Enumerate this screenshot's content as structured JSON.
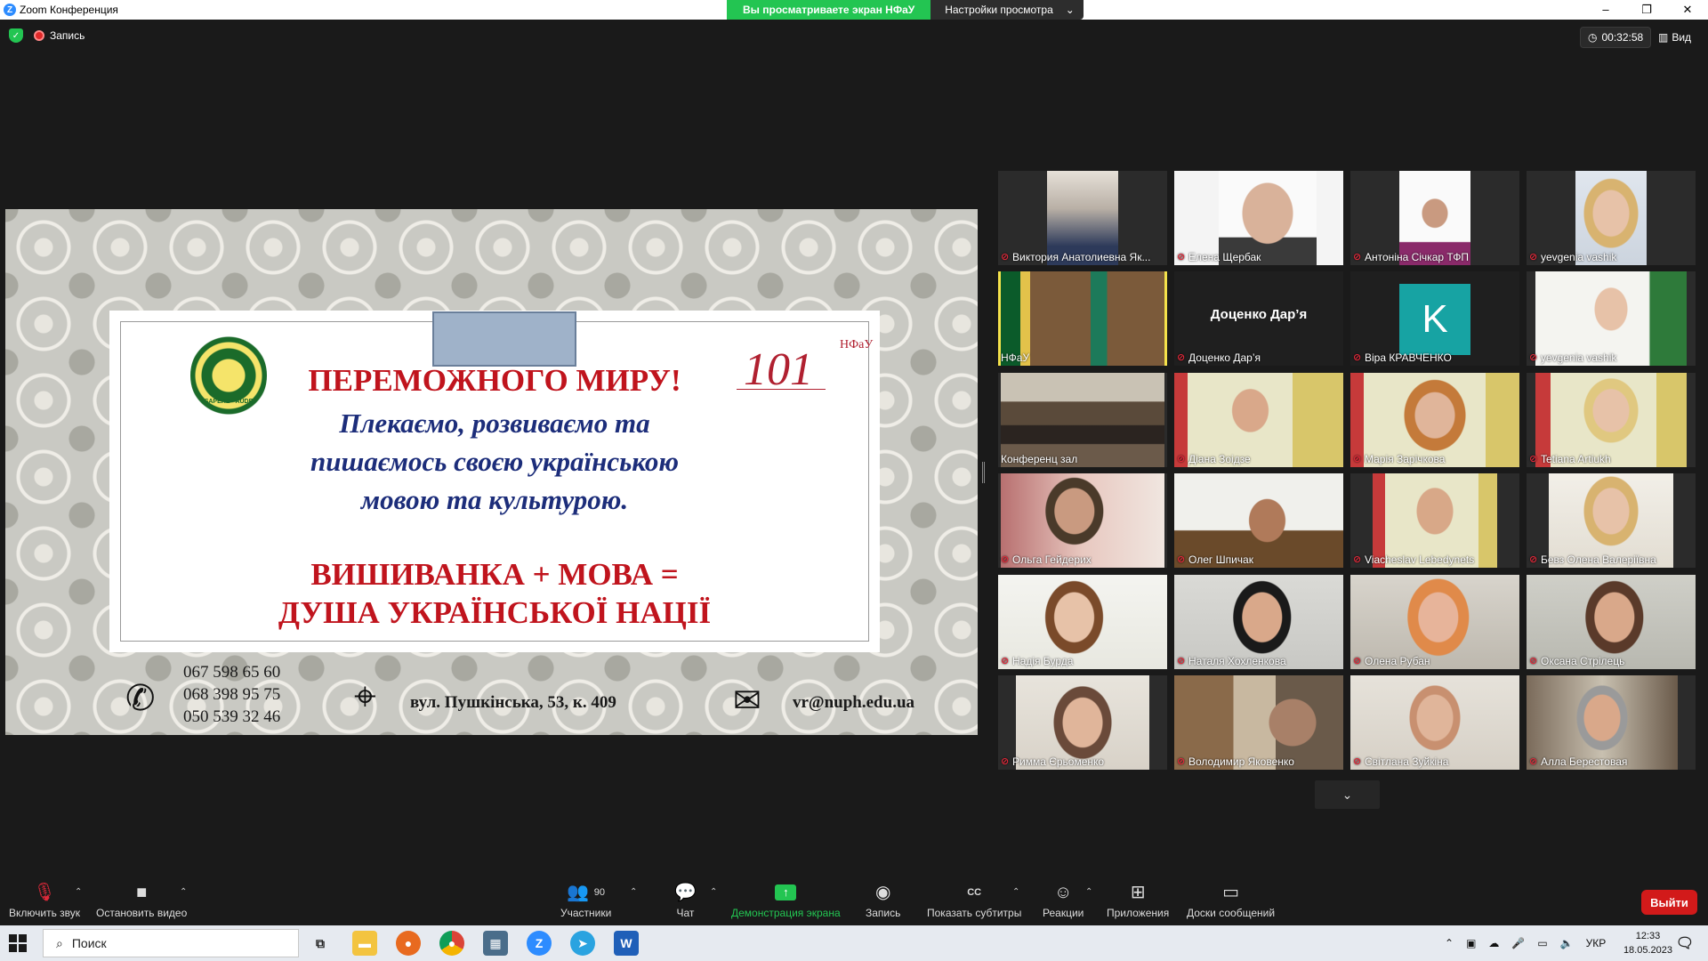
{
  "window": {
    "title": "Zoom Конференция",
    "share_banner": "Вы просматриваете экран НФаУ",
    "view_settings": "Настройки просмотра"
  },
  "status": {
    "recording": "Запись",
    "timer": "00:32:58",
    "view": "Вид"
  },
  "slide": {
    "headline": "ПЕРЕМОЖНОГО МИРУ!",
    "line1": "Плекаємо, розвиваємо та",
    "line2": "пишаємось своєю українською",
    "line3": "мовою та культурою.",
    "motto1": "ВИШИВАНКА + МОВА =",
    "motto2": "ДУША УКРАЇНСЬКОЇ НАЦІЇ",
    "emblem_year": "1805",
    "emblem_motto": "SAPERE · AUDE",
    "logo_number": "101",
    "logo_letters": "НФаУ",
    "phones": [
      "067 598 65 60",
      "068 398 95 75",
      "050 539 32 46"
    ],
    "address": "вул. Пушкінська, 53, к. 409",
    "email": "vr@nuph.edu.ua"
  },
  "participants": [
    {
      "name": "Виктория Анатолиевна Як...",
      "muted": true
    },
    {
      "name": "Елена Щербак",
      "muted": true
    },
    {
      "name": "Антоніна Січкар ТФП",
      "muted": true
    },
    {
      "name": "yevgenia vashik",
      "muted": true
    },
    {
      "name": "НФаУ",
      "muted": false,
      "active": true
    },
    {
      "name": "Доценко Дар’я",
      "muted": true,
      "center_name": "Доценко Дар’я"
    },
    {
      "name": "Віра КРАВЧЕНКО",
      "muted": true,
      "avatar_letter": "K"
    },
    {
      "name": "yevgenia vashik",
      "muted": true
    },
    {
      "name": "Конференц зал",
      "muted": false
    },
    {
      "name": "Діана Зоідзе",
      "muted": true
    },
    {
      "name": "Марія Зарічкова",
      "muted": true
    },
    {
      "name": "Tetiana Artiukh",
      "muted": true
    },
    {
      "name": "Ольга Гейдерих",
      "muted": true
    },
    {
      "name": "Олег Шпичак",
      "muted": true
    },
    {
      "name": "Viacheslav Lebedynets",
      "muted": true
    },
    {
      "name": "Бевз Олена Валеріївна",
      "muted": true
    },
    {
      "name": "Надія Бурда",
      "muted": true
    },
    {
      "name": "Наталя Хохленкова",
      "muted": true
    },
    {
      "name": "Олена Рубан",
      "muted": true
    },
    {
      "name": "Оксана Стрілець",
      "muted": true
    },
    {
      "name": "Римма Єрьоменко",
      "muted": true
    },
    {
      "name": "Володимир Яковенко",
      "muted": true
    },
    {
      "name": "Світлана Зуйкіна",
      "muted": true
    },
    {
      "name": "Алла Берестовая",
      "muted": true
    }
  ],
  "toolbar": {
    "unmute": "Включить звук",
    "stop_video": "Остановить видео",
    "participants": "Участники",
    "participants_count": "90",
    "chat": "Чат",
    "share": "Демонстрация экрана",
    "record": "Запись",
    "captions": "Показать субтитры",
    "captions_icon": "CC",
    "reactions": "Реакции",
    "apps": "Приложения",
    "whiteboards": "Доски сообщений",
    "leave": "Выйти"
  },
  "taskbar": {
    "search": "Поиск",
    "lang": "УКР",
    "time": "12:33",
    "date": "18.05.2023",
    "word_letter": "W",
    "zoom_letter": "Z"
  },
  "colors": {
    "share_green": "#23c552",
    "leave_red": "#d21a1a",
    "active_border": "#f5e24b",
    "slide_red": "#c0141d",
    "slide_blue": "#1c2d7a"
  }
}
